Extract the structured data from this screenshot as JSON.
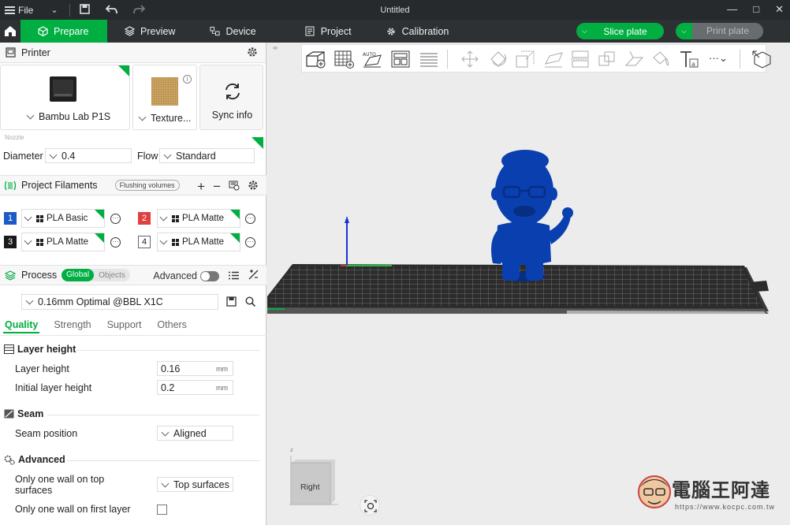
{
  "titlebar": {
    "file_label": "File",
    "title": "Untitled"
  },
  "nav": {
    "tabs": [
      {
        "label": "Prepare",
        "active": true
      },
      {
        "label": "Preview"
      },
      {
        "label": "Device"
      },
      {
        "label": "Project"
      },
      {
        "label": "Calibration"
      }
    ],
    "slice_label": "Slice plate",
    "print_label": "Print plate"
  },
  "printer": {
    "section_title": "Printer",
    "printer_name": "Bambu Lab P1S",
    "plate_name": "Texture...",
    "sync_label": "Sync info",
    "nozzle_label": "Nozzle",
    "diameter_label": "Diameter",
    "diameter_value": "0.4",
    "flow_label": "Flow",
    "flow_value": "Standard"
  },
  "filaments": {
    "section_title": "Project Filaments",
    "flushing_label": "Flushing volumes",
    "items": [
      {
        "num": "1",
        "color": "#1e5bc6",
        "name": "PLA Basic"
      },
      {
        "num": "2",
        "color": "#e04040",
        "name": "PLA Matte"
      },
      {
        "num": "3",
        "color": "#1a1a1a",
        "name": "PLA Matte"
      },
      {
        "num": "4",
        "color": "#ffffff",
        "name": "PLA Matte"
      }
    ]
  },
  "process": {
    "section_title": "Process",
    "global_label": "Global",
    "objects_label": "Objects",
    "advanced_label": "Advanced",
    "preset": "0.16mm Optimal @BBL X1C",
    "tabs": [
      "Quality",
      "Strength",
      "Support",
      "Others"
    ],
    "layer_group": "Layer height",
    "layer_height_label": "Layer height",
    "layer_height_value": "0.16",
    "initial_layer_label": "Initial layer height",
    "initial_layer_value": "0.2",
    "unit": "mm",
    "seam_group": "Seam",
    "seam_position_label": "Seam position",
    "seam_position_value": "Aligned",
    "advanced_group": "Advanced",
    "one_wall_top_label_1": "Only one wall on top",
    "one_wall_top_label_2": "surfaces",
    "one_wall_top_value": "Top surfaces",
    "one_wall_first_label": "Only one wall on first layer"
  },
  "viewport": {
    "orientation_label": "Right",
    "axis_z": "z",
    "model_color": "#0a3fb0",
    "accent": "#00ae42"
  },
  "watermark": {
    "text": "電腦王阿達",
    "url": "https://www.kocpc.com.tw"
  }
}
